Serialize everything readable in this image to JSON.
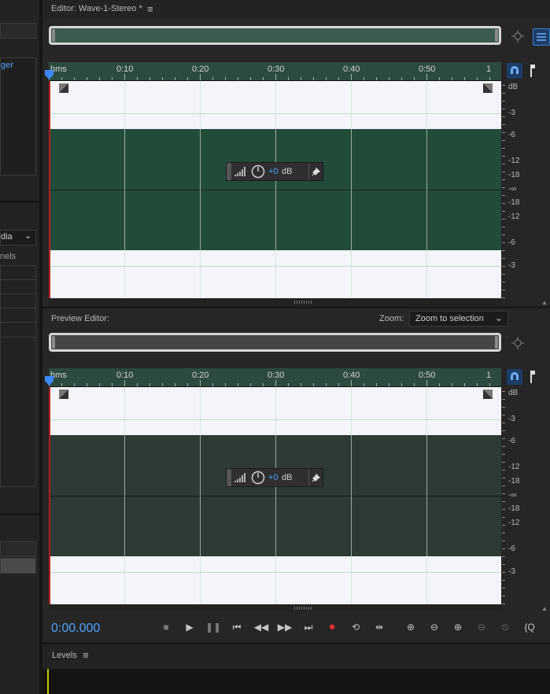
{
  "left": {
    "top_item": "ger",
    "dropdown_value": "dia",
    "label": "nels"
  },
  "editor": {
    "title": "Editor: Wave-1-Stereo *",
    "menu_icon": "hamburger-icon"
  },
  "ruler": {
    "labels": [
      "hms",
      "0:10",
      "0:20",
      "0:30",
      "0:40",
      "0:50",
      "1"
    ]
  },
  "db_scale": {
    "unit": "dB",
    "top": [
      "-3",
      "-6",
      "-12",
      "-18",
      "-∞",
      "-18",
      "-12",
      "-6",
      "-3"
    ]
  },
  "hud": {
    "value": "+0",
    "unit": "dB"
  },
  "preview": {
    "title": "Preview Editor:",
    "zoom_label": "Zoom:",
    "zoom_value": "Zoom to selection"
  },
  "transport": {
    "time": "0:00.000"
  },
  "levels": {
    "title": "Levels"
  },
  "colors": {
    "ruler_green": "#2d4a3e",
    "wave_green": "#234b3a",
    "wave_dim": "#2d3a35",
    "playhead_blue": "#3b8bff",
    "record_red": "#e03030",
    "time_blue": "#4da3ff"
  }
}
